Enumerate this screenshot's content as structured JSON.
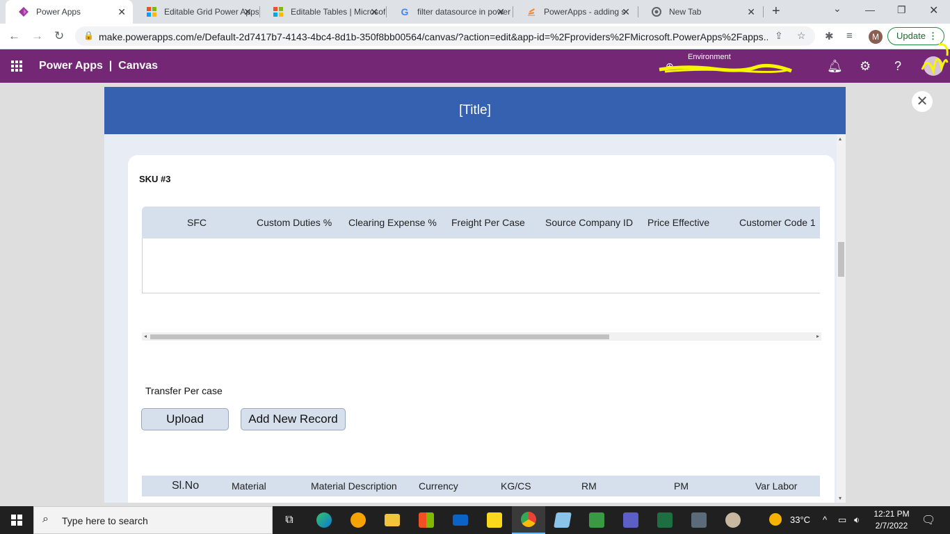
{
  "browser": {
    "tabs": [
      {
        "label": "Power Apps"
      },
      {
        "label": "Editable Grid Power Apps"
      },
      {
        "label": "Editable Tables | Microsoft"
      },
      {
        "label": "filter datasource in power"
      },
      {
        "label": "PowerApps - adding s"
      },
      {
        "label": "New Tab"
      }
    ],
    "url": "make.powerapps.com/e/Default-2d7417b7-4143-4bc4-8d1b-350f8bb00564/canvas/?action=edit&app-id=%2Fproviders%2FMicrosoft.PowerApps%2Fapps",
    "url_suffix": "...",
    "profile_initial": "M",
    "update_label": "Update"
  },
  "header": {
    "app_name": "Power Apps",
    "separator": "|",
    "section": "Canvas",
    "environment_label": "Environment"
  },
  "app": {
    "title": "[Title]",
    "sku_label": "SKU #3",
    "grid1_columns": [
      "SFC",
      "Custom Duties %",
      "Clearing Expense %",
      "Freight Per Case",
      "Source Company ID",
      "Price Effective",
      "Customer Code 1"
    ],
    "transfer_label": "Transfer Per case",
    "upload_label": "Upload",
    "add_record_label": "Add New Record",
    "grid2_columns": [
      "Sl.No",
      "Material",
      "Material Description",
      "Currency",
      "KG/CS",
      "RM",
      "PM",
      "Var Labor"
    ]
  },
  "taskbar": {
    "search_placeholder": "Type here to search",
    "temperature": "33°C",
    "time": "12:21 PM",
    "date": "2/7/2022"
  },
  "colors": {
    "powerapps_purple": "#742774",
    "title_blue": "#3660b0",
    "grid_header": "#d6dfec"
  }
}
